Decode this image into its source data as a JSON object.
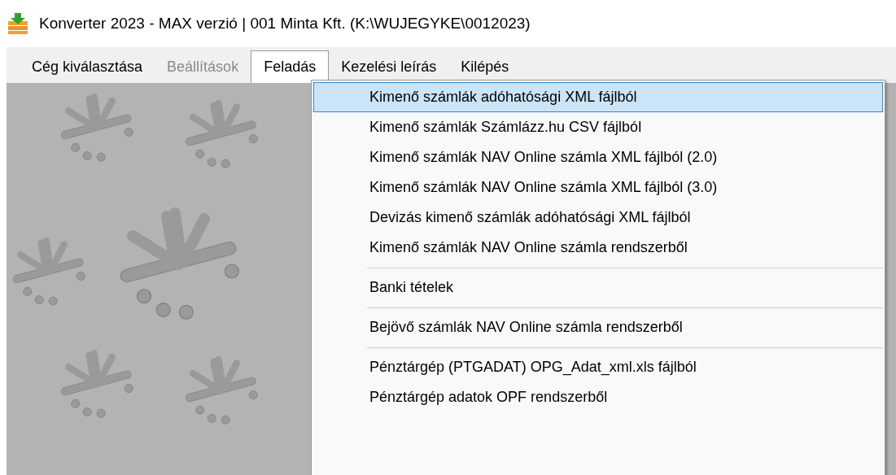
{
  "window": {
    "title": "Konverter 2023 - MAX verzió  | 001 Minta Kft. (K:\\WUJEGYKE\\0012023)"
  },
  "menu_bar": [
    {
      "label": "Cég kiválasztása",
      "disabled": false,
      "selected": false
    },
    {
      "label": "Beállítások",
      "disabled": true,
      "selected": false
    },
    {
      "label": "Feladás",
      "disabled": false,
      "selected": true
    },
    {
      "label": "Kezelési leírás",
      "disabled": false,
      "selected": false
    },
    {
      "label": "Kilépés",
      "disabled": false,
      "selected": false
    }
  ],
  "dropdown": {
    "items": [
      {
        "kind": "item",
        "label": "Kimenő számlák adóhatósági XML fájlból",
        "selected": true
      },
      {
        "kind": "item",
        "label": "Kimenő számlák Számlázz.hu CSV fájlból",
        "selected": false
      },
      {
        "kind": "item",
        "label": "Kimenő számlák NAV Online számla XML fájlból (2.0)",
        "selected": false
      },
      {
        "kind": "item",
        "label": "Kimenő számlák NAV Online számla XML fájlból (3.0)",
        "selected": false
      },
      {
        "kind": "item",
        "label": "Devizás kimenő számlák adóhatósági XML fájlból",
        "selected": false
      },
      {
        "kind": "item",
        "label": "Kimenő számlák NAV Online számla rendszerből",
        "selected": false
      },
      {
        "kind": "separator"
      },
      {
        "kind": "item",
        "label": "Banki tételek",
        "selected": false
      },
      {
        "kind": "separator"
      },
      {
        "kind": "item",
        "label": "Bejövő számlák NAV Online számla rendszerből",
        "selected": false
      },
      {
        "kind": "separator"
      },
      {
        "kind": "item",
        "label": "Pénztárgép (PTGADAT) OPG_Adat_xml.xls fájlból",
        "selected": false
      },
      {
        "kind": "item",
        "label": "Pénztárgép adatok OPF rendszerből",
        "selected": false
      }
    ]
  }
}
